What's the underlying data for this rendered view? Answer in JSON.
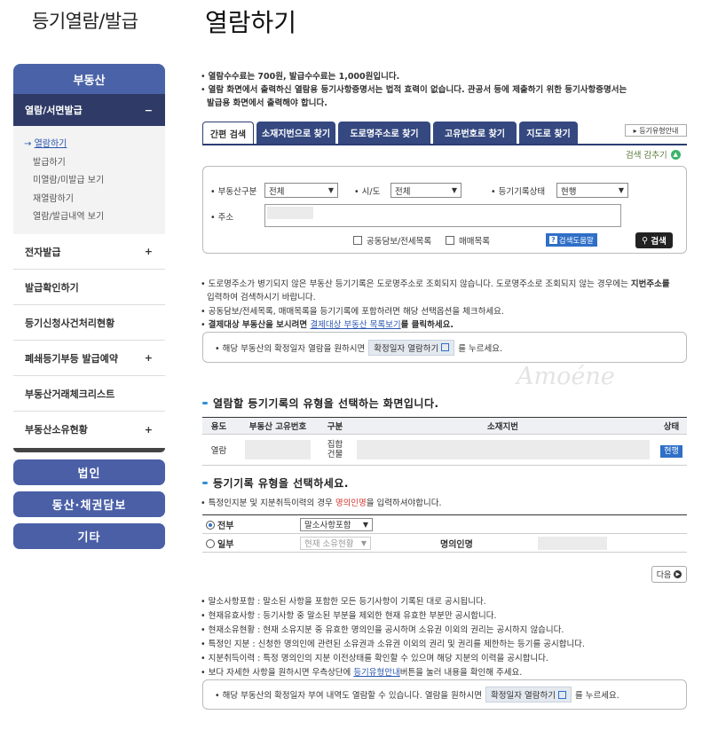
{
  "sidebar": {
    "title": "등기열람/발급",
    "top_menu": "부동산",
    "active_menu": "열람/서면발급",
    "active_toggle": "−",
    "submenu": [
      "열람하기",
      "발급하기",
      "미열람/미발급 보기",
      "재열람하기",
      "열람/발급내역 보기"
    ],
    "items": [
      {
        "label": "전자발급",
        "toggle": "+"
      },
      {
        "label": "발급확인하기",
        "toggle": ""
      },
      {
        "label": "등기신청사건처리현황",
        "toggle": ""
      },
      {
        "label": "폐쇄등기부등 발급예약",
        "toggle": "+"
      },
      {
        "label": "부동산거래체크리스트",
        "toggle": ""
      },
      {
        "label": "부동산소유현황",
        "toggle": "+"
      }
    ],
    "buttons": [
      "법인",
      "동산·채권담보",
      "기타"
    ]
  },
  "main": {
    "title": "열람하기",
    "fee_notes": [
      "열람수수료는 700원, 발급수수료는 1,000원입니다.",
      "열람 화면에서 출력하신 열람용 등기사항증명서는 법적 효력이 없습니다. 관공서 등에 제출하기 위한 등기사항증명서는",
      "발급용 화면에서 출력해야 합니다."
    ],
    "tabs": [
      "간편 검색",
      "소재지번으로 찾기",
      "도로명주소로 찾기",
      "고유번호로 찾기",
      "지도로 찾기"
    ],
    "guide_button": "등기유형안내",
    "collapse_label": "검색 감추기",
    "search": {
      "property_type_label": "부동산구분",
      "property_type_value": "전체",
      "region_label": "시/도",
      "region_value": "전체",
      "status_label": "등기기록상태",
      "status_value": "현행",
      "address_label": "주소",
      "check_collateral": "공동담보/전세목록",
      "check_sales": "매매목록",
      "help_button": "검색도움말",
      "search_button": "검색"
    },
    "info_notes": {
      "line1": "도로명주소가 병기되지 않은 부동산 등기기록은 도로명주소로 조회되지 않습니다. 도로명주소로 조회되지 않는 경우에는 ",
      "line1_bold": "지번주소를",
      "line2": "입력하여 검색하시기 바랍니다.",
      "line3": "공동담보/전세목록, 매매목록을 등기기록에 포함하려면 해당 선택옵션을 체크하세요.",
      "line4_pre": "결제대상 부동산을 보시려면 ",
      "line4_link": "결제대상 부동산 목록보기",
      "line4_post": "를 클릭하세요."
    },
    "confirm_notice_1": {
      "pre": "해당 부동산의 확정일자 열람을 원하시면",
      "button": "확정일자 열람하기",
      "post": "를 누르세요."
    },
    "watermark": "Amoéne",
    "record_section_title": "열람할 등기기록의 유형을 선택하는 화면입니다.",
    "record_table": {
      "headers": [
        "용도",
        "부동산 고유번호",
        "구분",
        "소재지번",
        "상태"
      ],
      "row": {
        "use": "열람",
        "type": "집합건물",
        "status": "현행"
      }
    },
    "type_section_title": "등기기록 유형을 선택하세요.",
    "type_note_pre": "특정인지분 및 지분취득이력의 경우 ",
    "type_note_red": "명의인명",
    "type_note_post": "을 입력하셔야합니다.",
    "type_table": {
      "all_label": "전부",
      "all_select": "말소사항포함",
      "part_label": "일부",
      "part_select": "현재 소유현황",
      "owner_label": "명의인명"
    },
    "next_button": "다음",
    "desc_notes": [
      "말소사항포함 : 말소된 사항을 포함한 모든 등기사항이 기록된 대로 공시됩니다.",
      "현재유효사항 : 등기사항 중 말소된 부분을 제외한 현재 유효한 부분만 공시합니다.",
      "현재소유현황 : 현재 소유지분 중 유효한 명의인을 공시하며 소유권 이외의 권리는 공시하지 않습니다.",
      "특정인 지분 : 신청한 명의인에 관련된 소유권과 소유권 이외의 권리 및 권리를 제한하는 등기를 공시합니다.",
      "지분취득이력 : 특정 명의인의 지분 이전상태를 확인할 수 있으며 해당 지분의 이력을 공시합니다."
    ],
    "desc_last_pre": "보다 자세한 사항을 원하시면 우측상단에 ",
    "desc_last_link": "등기유형안내",
    "desc_last_post": "버튼을 눌러 내용을 확인해 주세요.",
    "confirm_notice_2": {
      "pre": "해당 부동산의 확정일자 부여 내역도 열람할 수 있습니다. 열람을 원하시면",
      "button": "확정일자 열람하기",
      "post": "를 누르세요."
    }
  }
}
